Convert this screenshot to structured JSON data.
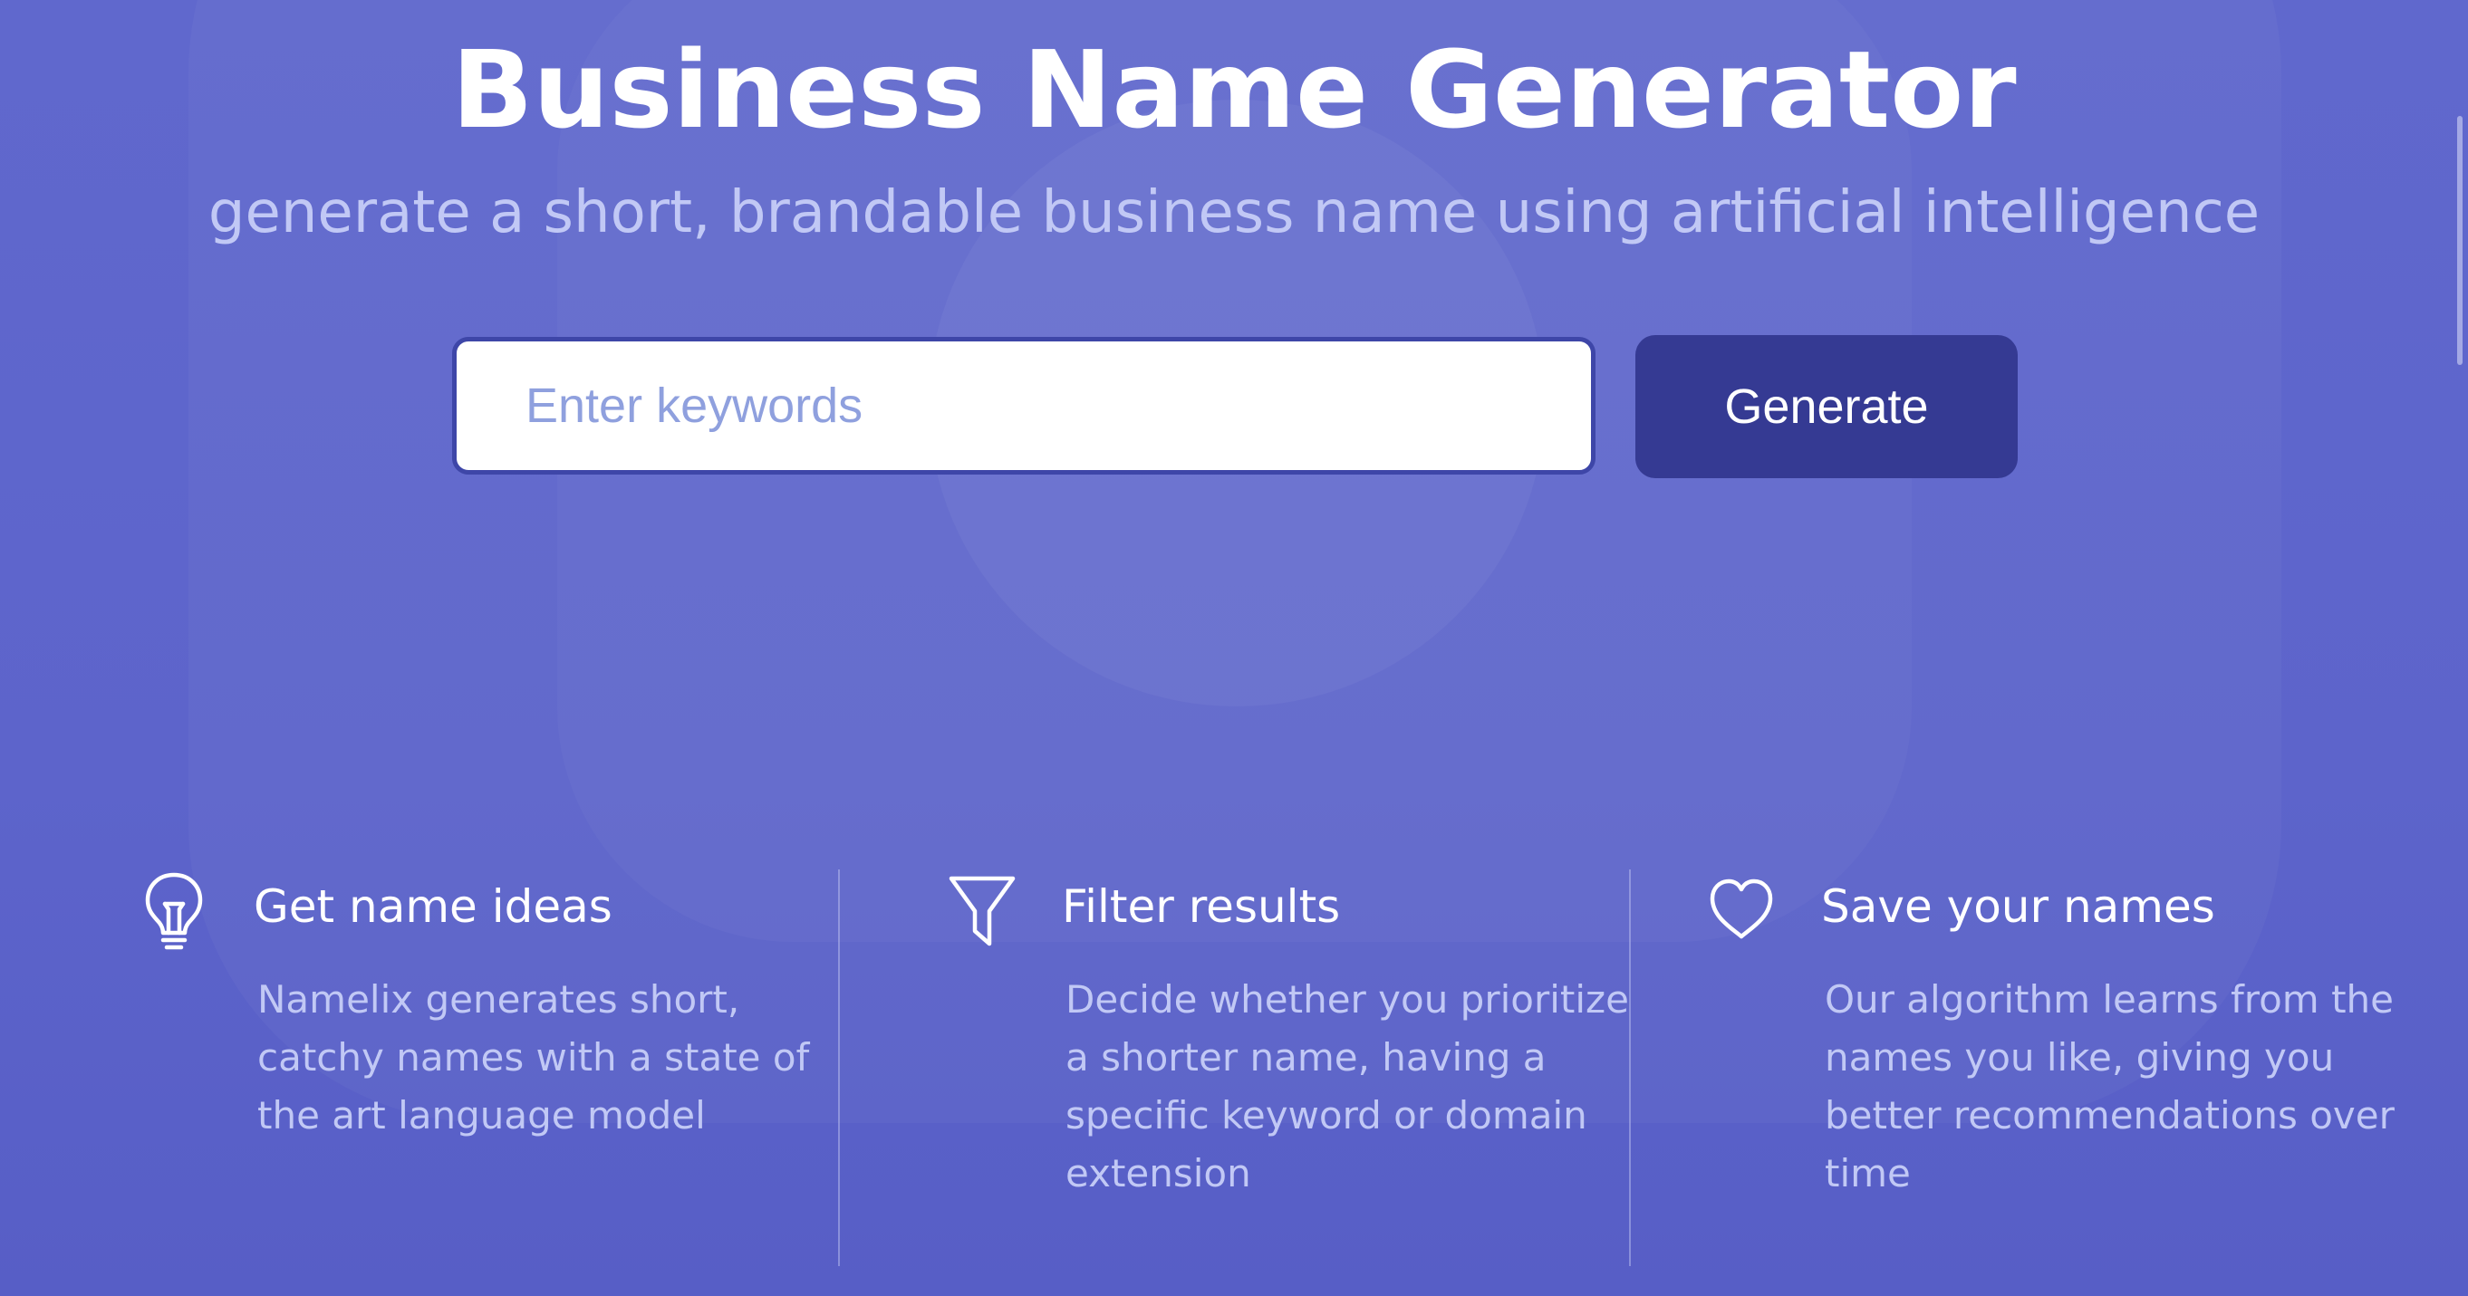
{
  "hero": {
    "title": "Business Name Generator",
    "subtitle": "generate a short, brandable business name using artificial intelligence"
  },
  "search": {
    "placeholder": "Enter keywords",
    "value": "",
    "button_label": "Generate"
  },
  "features": [
    {
      "icon": "lightbulb-icon",
      "title": "Get name ideas",
      "description": "Namelix generates short, catchy names with a state of the art language model"
    },
    {
      "icon": "filter-icon",
      "title": "Filter results",
      "description": "Decide whether you prioritize a shorter name, having a specific keyword or domain extension"
    },
    {
      "icon": "heart-icon",
      "title": "Save your names",
      "description": "Our algorithm learns from the names you like, giving you better recommendations over time"
    }
  ],
  "colors": {
    "background": "#5f66cc",
    "button": "#353a93",
    "input_border": "#3e46a8",
    "subtitle_text": "#c1c8f5"
  }
}
